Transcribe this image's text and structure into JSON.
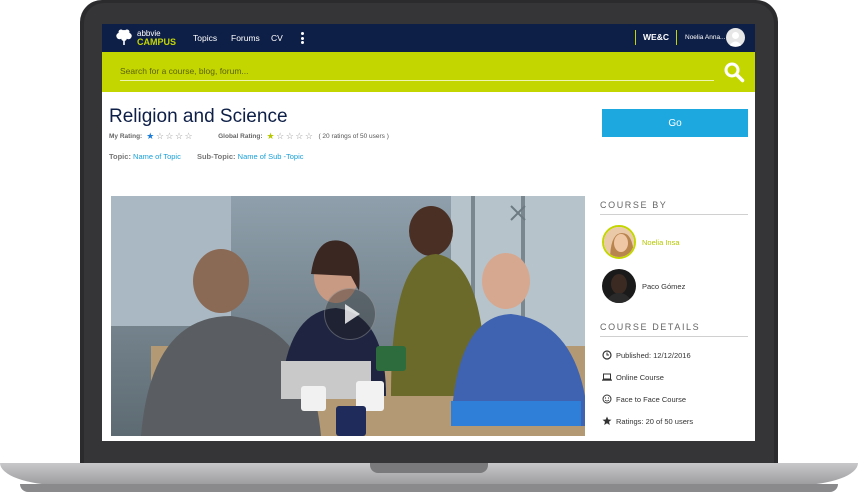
{
  "nav": {
    "logo_top": "abbvie",
    "logo_bottom": "CAMPUS",
    "links": [
      "Topics",
      "Forums",
      "CV"
    ],
    "wec": "WE&C",
    "user_name": "Noelia Anna..."
  },
  "search": {
    "placeholder": "Search for a course, blog, forum..."
  },
  "course": {
    "title": "Religion and Science",
    "my_rating_label": "My Rating:",
    "my_rating": 1,
    "global_rating_label": "Global Rating:",
    "global_rating": 1,
    "max_rating": 5,
    "ratings_count": "( 20 ratings of 50 users )",
    "topic_label": "Topic:",
    "topic_value": "Name of Topic",
    "subtopic_label": "Sub-Topic:",
    "subtopic_value": "Name of Sub -Topic",
    "go_label": "Go"
  },
  "sidebar": {
    "course_by_title": "COURSE BY",
    "authors": [
      {
        "name": "Noelia Insa",
        "color": "#b6c800"
      },
      {
        "name": "Paco Gómez",
        "color": "#333333"
      }
    ],
    "details_title": "COURSE DETAILS",
    "details": [
      {
        "icon": "clock-icon",
        "text": "Published: 12/12/2016"
      },
      {
        "icon": "laptop-icon",
        "text": "Online Course"
      },
      {
        "icon": "smiley-icon",
        "text": "Face to Face Course"
      },
      {
        "icon": "star-icon",
        "text": "Ratings: 20 of 50 users"
      }
    ]
  },
  "colors": {
    "nav_bg": "#0e1f47",
    "accent_green": "#c4d600",
    "button_blue": "#1ea8e0",
    "link_blue": "#1aa0d8"
  }
}
